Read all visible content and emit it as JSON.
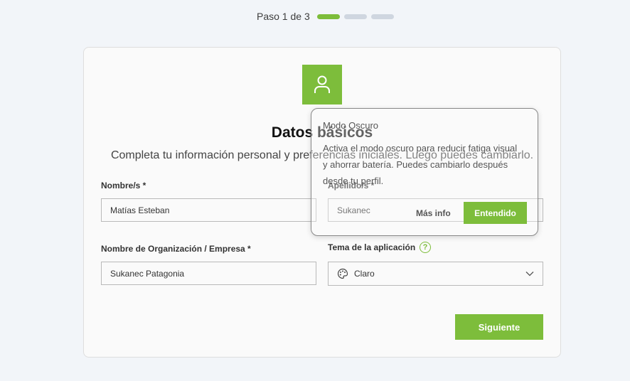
{
  "stepper": {
    "text": "Paso 1 de 3",
    "current_step": 1,
    "total_steps": 3
  },
  "header": {
    "title": "Datos básicos",
    "subtitle": "Completa tu información personal y preferencias iniciales. Luego puedes cambiarlo."
  },
  "form": {
    "first_name": {
      "label": "Nombre/s *",
      "value": "Matías Esteban"
    },
    "last_name": {
      "label": "Apellido/s *",
      "value": "Sukanec"
    },
    "organization": {
      "label": "Nombre de Organización / Empresa *",
      "value": "Sukanec Patagonia"
    },
    "theme": {
      "label": "Tema de la aplicación",
      "value": "Claro",
      "help": "?"
    }
  },
  "actions": {
    "next_label": "Siguiente"
  },
  "tooltip": {
    "title": "Modo Oscuro",
    "body": "Activa el modo oscuro para reducir fatiga visual y ahorrar batería. Puedes cambiarlo después desde tu perfil.",
    "more_label": "Más info",
    "ok_label": "Entendido"
  },
  "colors": {
    "accent": "#7dbd3b",
    "inactive_step": "#cfd6e0",
    "background": "#f2f5f9"
  },
  "icons": {
    "avatar": "user-icon",
    "theme": "palette-icon",
    "dropdown": "chevron-down-icon",
    "help": "question-circle-icon"
  }
}
